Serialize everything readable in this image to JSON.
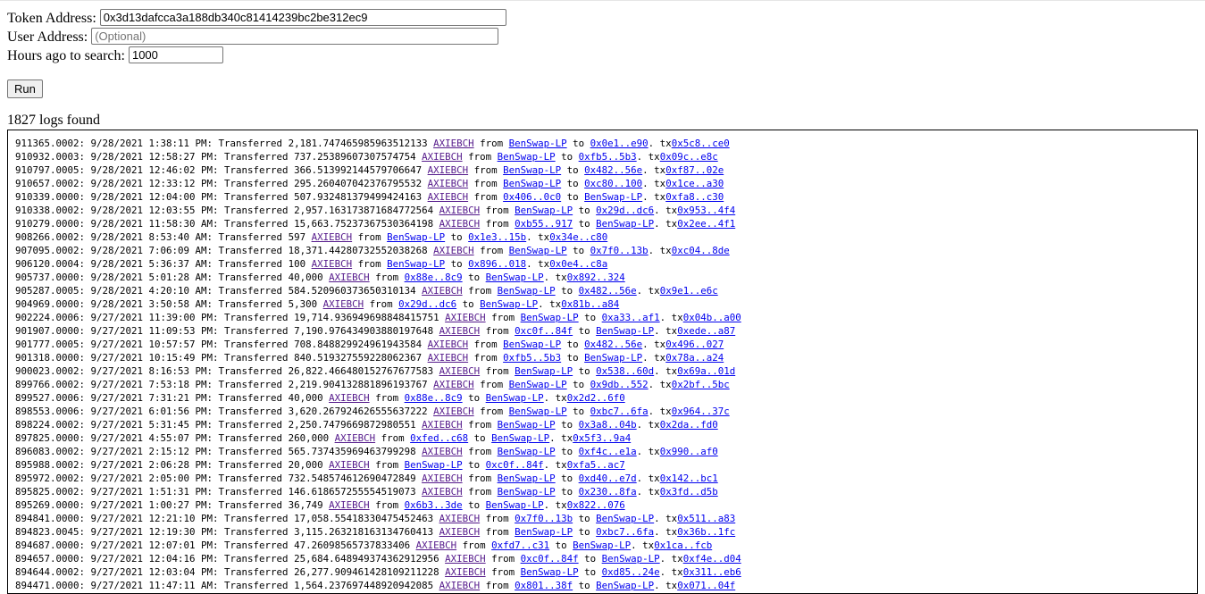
{
  "form": {
    "token_label": "Token Address:",
    "token_value": "0x3d13dafcca3a188db340c81414239bc2be312ec9",
    "user_label": "User Address:",
    "user_placeholder": "(Optional)",
    "hours_label": "Hours ago to search:",
    "hours_value": "1000",
    "run_label": "Run"
  },
  "results": {
    "count_text": "1827 logs found"
  },
  "logs": [
    {
      "block": "911365.0002",
      "time": "9/28/2021 1:38:11 PM",
      "amount": "2,181.747465985963512133",
      "symbol": "AXIEBCH",
      "from": "BenSwap-LP",
      "to": "0x0e1..e90",
      "tx": "0x5c8..ce0"
    },
    {
      "block": "910932.0003",
      "time": "9/28/2021 12:58:27 PM",
      "amount": "737.25389607307574754",
      "symbol": "AXIEBCH",
      "from": "BenSwap-LP",
      "to": "0xfb5..5b3",
      "tx": "0x09c..e8c"
    },
    {
      "block": "910797.0005",
      "time": "9/28/2021 12:46:02 PM",
      "amount": "366.513992144579706647",
      "symbol": "AXIEBCH",
      "from": "BenSwap-LP",
      "to": "0x482..56e",
      "tx": "0xf87..02e"
    },
    {
      "block": "910657.0002",
      "time": "9/28/2021 12:33:12 PM",
      "amount": "295.260407042376795532",
      "symbol": "AXIEBCH",
      "from": "BenSwap-LP",
      "to": "0xc80..100",
      "tx": "0x1ce..a30"
    },
    {
      "block": "910339.0000",
      "time": "9/28/2021 12:04:00 PM",
      "amount": "507.932481379499424163",
      "symbol": "AXIEBCH",
      "from": "0x406..0c0",
      "to": "BenSwap-LP",
      "tx": "0xfa8..c30"
    },
    {
      "block": "910338.0002",
      "time": "9/28/2021 12:03:55 PM",
      "amount": "2,957.163173871684772564",
      "symbol": "AXIEBCH",
      "from": "BenSwap-LP",
      "to": "0x29d..dc6",
      "tx": "0x953..4f4"
    },
    {
      "block": "910279.0000",
      "time": "9/28/2021 11:58:30 AM",
      "amount": "15,663.75237367530364198",
      "symbol": "AXIEBCH",
      "from": "0xb55..917",
      "to": "BenSwap-LP",
      "tx": "0x2ee..4f1"
    },
    {
      "block": "908266.0002",
      "time": "9/28/2021 8:53:40 AM",
      "amount": "597",
      "symbol": "AXIEBCH",
      "from": "BenSwap-LP",
      "to": "0x1e3..15b",
      "tx": "0x34e..c80"
    },
    {
      "block": "907095.0002",
      "time": "9/28/2021 7:06:09 AM",
      "amount": "18,371.44280732552038268",
      "symbol": "AXIEBCH",
      "from": "BenSwap-LP",
      "to": "0x7f0..13b",
      "tx": "0xc04..8de"
    },
    {
      "block": "906120.0004",
      "time": "9/28/2021 5:36:37 AM",
      "amount": "100",
      "symbol": "AXIEBCH",
      "from": "BenSwap-LP",
      "to": "0x896..018",
      "tx": "0x0e4..c8a"
    },
    {
      "block": "905737.0000",
      "time": "9/28/2021 5:01:28 AM",
      "amount": "40,000",
      "symbol": "AXIEBCH",
      "from": "0x88e..8c9",
      "to": "BenSwap-LP",
      "tx": "0x892..324"
    },
    {
      "block": "905287.0005",
      "time": "9/28/2021 4:20:10 AM",
      "amount": "584.520960373650310134",
      "symbol": "AXIEBCH",
      "from": "BenSwap-LP",
      "to": "0x482..56e",
      "tx": "0x9e1..e6c"
    },
    {
      "block": "904969.0000",
      "time": "9/28/2021 3:50:58 AM",
      "amount": "5,300",
      "symbol": "AXIEBCH",
      "from": "0x29d..dc6",
      "to": "BenSwap-LP",
      "tx": "0x81b..a84"
    },
    {
      "block": "902224.0006",
      "time": "9/27/2021 11:39:00 PM",
      "amount": "19,714.936949698848415751",
      "symbol": "AXIEBCH",
      "from": "BenSwap-LP",
      "to": "0xa33..af1",
      "tx": "0x04b..a00"
    },
    {
      "block": "901907.0000",
      "time": "9/27/2021 11:09:53 PM",
      "amount": "7,190.976434903880197648",
      "symbol": "AXIEBCH",
      "from": "0xc0f..84f",
      "to": "BenSwap-LP",
      "tx": "0xede..a87"
    },
    {
      "block": "901777.0005",
      "time": "9/27/2021 10:57:57 PM",
      "amount": "708.848829924961943584",
      "symbol": "AXIEBCH",
      "from": "BenSwap-LP",
      "to": "0x482..56e",
      "tx": "0x496..027"
    },
    {
      "block": "901318.0000",
      "time": "9/27/2021 10:15:49 PM",
      "amount": "840.519327559228062367",
      "symbol": "AXIEBCH",
      "from": "0xfb5..5b3",
      "to": "BenSwap-LP",
      "tx": "0x78a..a24"
    },
    {
      "block": "900023.0002",
      "time": "9/27/2021 8:16:53 PM",
      "amount": "26,822.466480152767677583",
      "symbol": "AXIEBCH",
      "from": "BenSwap-LP",
      "to": "0x538..60d",
      "tx": "0x69a..01d"
    },
    {
      "block": "899766.0002",
      "time": "9/27/2021 7:53:18 PM",
      "amount": "2,219.904132881896193767",
      "symbol": "AXIEBCH",
      "from": "BenSwap-LP",
      "to": "0x9db..552",
      "tx": "0x2bf..5bc"
    },
    {
      "block": "899527.0006",
      "time": "9/27/2021 7:31:21 PM",
      "amount": "40,000",
      "symbol": "AXIEBCH",
      "from": "0x88e..8c9",
      "to": "BenSwap-LP",
      "tx": "0x2d2..6f0"
    },
    {
      "block": "898553.0006",
      "time": "9/27/2021 6:01:56 PM",
      "amount": "3,620.267924626555637222",
      "symbol": "AXIEBCH",
      "from": "BenSwap-LP",
      "to": "0xbc7..6fa",
      "tx": "0x964..37c"
    },
    {
      "block": "898224.0002",
      "time": "9/27/2021 5:31:45 PM",
      "amount": "2,250.7479669872980551",
      "symbol": "AXIEBCH",
      "from": "BenSwap-LP",
      "to": "0x3a8..04b",
      "tx": "0x2da..fd0"
    },
    {
      "block": "897825.0000",
      "time": "9/27/2021 4:55:07 PM",
      "amount": "260,000",
      "symbol": "AXIEBCH",
      "from": "0xfed..c68",
      "to": "BenSwap-LP",
      "tx": "0x5f3..9a4"
    },
    {
      "block": "896083.0002",
      "time": "9/27/2021 2:15:12 PM",
      "amount": "565.737435969463799298",
      "symbol": "AXIEBCH",
      "from": "BenSwap-LP",
      "to": "0xf4c..e1a",
      "tx": "0x990..af0"
    },
    {
      "block": "895988.0002",
      "time": "9/27/2021 2:06:28 PM",
      "amount": "20,000",
      "symbol": "AXIEBCH",
      "from": "BenSwap-LP",
      "to": "0xc0f..84f",
      "tx": "0xfa5..ac7"
    },
    {
      "block": "895972.0002",
      "time": "9/27/2021 2:05:00 PM",
      "amount": "732.548574612690472849",
      "symbol": "AXIEBCH",
      "from": "BenSwap-LP",
      "to": "0xd40..e7d",
      "tx": "0x142..bc1"
    },
    {
      "block": "895825.0002",
      "time": "9/27/2021 1:51:31 PM",
      "amount": "146.618657255554519073",
      "symbol": "AXIEBCH",
      "from": "BenSwap-LP",
      "to": "0x230..8fa",
      "tx": "0x3fd..d5b"
    },
    {
      "block": "895269.0000",
      "time": "9/27/2021 1:00:27 PM",
      "amount": "36,749",
      "symbol": "AXIEBCH",
      "from": "0x6b3..3de",
      "to": "BenSwap-LP",
      "tx": "0x822..076"
    },
    {
      "block": "894841.0000",
      "time": "9/27/2021 12:21:10 PM",
      "amount": "17,058.55418330475452463",
      "symbol": "AXIEBCH",
      "from": "0x7f0..13b",
      "to": "BenSwap-LP",
      "tx": "0x511..a83"
    },
    {
      "block": "894823.0045",
      "time": "9/27/2021 12:19:30 PM",
      "amount": "3,115.263218163134760413",
      "symbol": "AXIEBCH",
      "from": "BenSwap-LP",
      "to": "0xbc7..6fa",
      "tx": "0x36b..1fc"
    },
    {
      "block": "894687.0000",
      "time": "9/27/2021 12:07:01 PM",
      "amount": "47.26098565737833406",
      "symbol": "AXIEBCH",
      "from": "0xfd7..c31",
      "to": "BenSwap-LP",
      "tx": "0x1ca..fcb"
    },
    {
      "block": "894657.0000",
      "time": "9/27/2021 12:04:16 PM",
      "amount": "25,684.648949374362912956",
      "symbol": "AXIEBCH",
      "from": "0xc0f..84f",
      "to": "BenSwap-LP",
      "tx": "0xf4e..d04"
    },
    {
      "block": "894644.0002",
      "time": "9/27/2021 12:03:04 PM",
      "amount": "26,277.909461428109211228",
      "symbol": "AXIEBCH",
      "from": "BenSwap-LP",
      "to": "0xd85..24e",
      "tx": "0x311..eb6"
    },
    {
      "block": "894471.0000",
      "time": "9/27/2021 11:47:11 AM",
      "amount": "1,564.237697448920942085",
      "symbol": "AXIEBCH",
      "from": "0x801..38f",
      "to": "BenSwap-LP",
      "tx": "0x071..04f"
    }
  ],
  "text": {
    "sep": ": ",
    "transferred": ": Transferred ",
    "from": " from ",
    "to": " to ",
    "tx": ". tx"
  }
}
